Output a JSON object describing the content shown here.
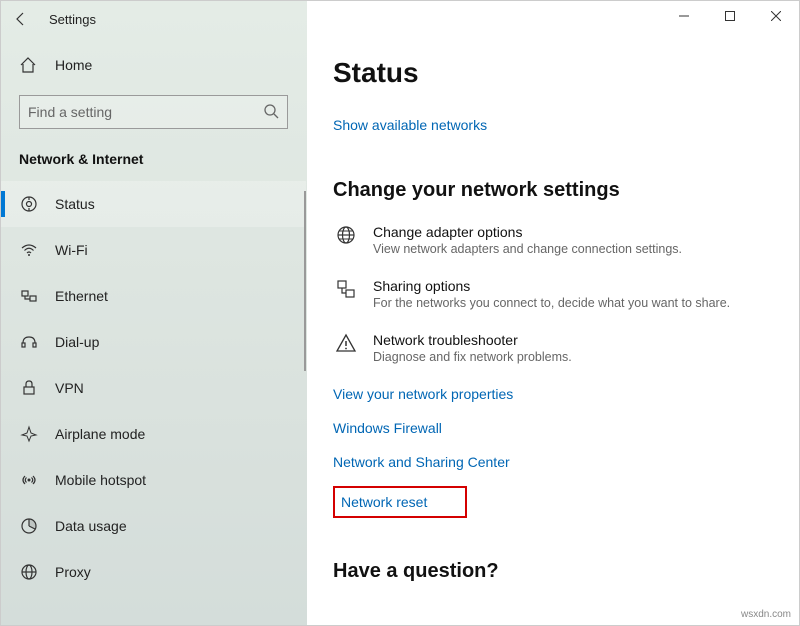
{
  "titlebar": {
    "title": "Settings"
  },
  "search": {
    "placeholder": "Find a setting"
  },
  "home_label": "Home",
  "category": "Network & Internet",
  "nav": [
    {
      "label": "Status",
      "icon": "status-icon",
      "active": true
    },
    {
      "label": "Wi-Fi",
      "icon": "wifi-icon",
      "active": false
    },
    {
      "label": "Ethernet",
      "icon": "ethernet-icon",
      "active": false
    },
    {
      "label": "Dial-up",
      "icon": "dialup-icon",
      "active": false
    },
    {
      "label": "VPN",
      "icon": "vpn-icon",
      "active": false
    },
    {
      "label": "Airplane mode",
      "icon": "airplane-icon",
      "active": false
    },
    {
      "label": "Mobile hotspot",
      "icon": "hotspot-icon",
      "active": false
    },
    {
      "label": "Data usage",
      "icon": "data-icon",
      "active": false
    },
    {
      "label": "Proxy",
      "icon": "proxy-icon",
      "active": false
    }
  ],
  "main": {
    "title": "Status",
    "link_available": "Show available networks",
    "section_change": "Change your network settings",
    "rows": [
      {
        "title": "Change adapter options",
        "desc": "View network adapters and change connection settings."
      },
      {
        "title": "Sharing options",
        "desc": "For the networks you connect to, decide what you want to share."
      },
      {
        "title": "Network troubleshooter",
        "desc": "Diagnose and fix network problems."
      }
    ],
    "links": [
      "View your network properties",
      "Windows Firewall",
      "Network and Sharing Center"
    ],
    "highlight_link": "Network reset",
    "question": "Have a question?"
  },
  "watermark": "wsxdn.com"
}
